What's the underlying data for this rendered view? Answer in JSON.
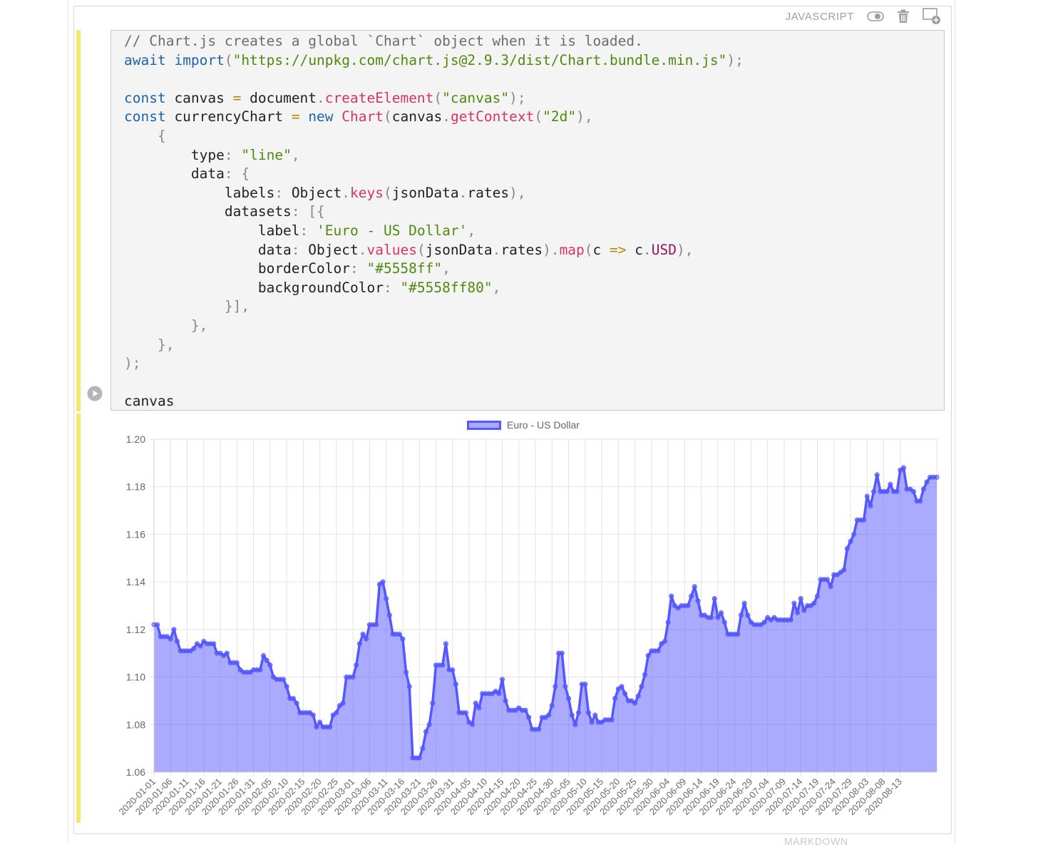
{
  "cell": {
    "language": "JAVASCRIPT",
    "code": [
      [
        [
          "com",
          "// Chart.js creates a global `Chart` object when it is loaded."
        ]
      ],
      [
        [
          "kw",
          "await"
        ],
        [
          "",
          "",
          ""
        ],
        [
          "txt",
          " "
        ],
        [
          "kw",
          "import"
        ],
        [
          "pun",
          "("
        ],
        [
          "str",
          "\"https://unpkg.com/chart.js@2.9.3/dist/Chart.bundle.min.js\""
        ],
        [
          "pun",
          ");"
        ]
      ],
      [],
      [
        [
          "kw",
          "const"
        ],
        [
          "txt",
          " canvas "
        ],
        [
          "op",
          "="
        ],
        [
          "txt",
          " document"
        ],
        [
          "pun",
          "."
        ],
        [
          "fn",
          "createElement"
        ],
        [
          "pun",
          "("
        ],
        [
          "str",
          "\"canvas\""
        ],
        [
          "pun",
          ");"
        ]
      ],
      [
        [
          "kw",
          "const"
        ],
        [
          "txt",
          " currencyChart "
        ],
        [
          "op",
          "="
        ],
        [
          "txt",
          " "
        ],
        [
          "kw",
          "new"
        ],
        [
          "txt",
          " "
        ],
        [
          "fn",
          "Chart"
        ],
        [
          "pun",
          "("
        ],
        [
          "txt",
          "canvas"
        ],
        [
          "pun",
          "."
        ],
        [
          "fn",
          "getContext"
        ],
        [
          "pun",
          "("
        ],
        [
          "str",
          "\"2d\""
        ],
        [
          "pun",
          "),"
        ]
      ],
      [
        [
          "pun",
          "    {"
        ]
      ],
      [
        [
          "txt",
          "        type"
        ],
        [
          "pun",
          ": "
        ],
        [
          "str",
          "\"line\""
        ],
        [
          "pun",
          ","
        ]
      ],
      [
        [
          "txt",
          "        data"
        ],
        [
          "pun",
          ": {"
        ]
      ],
      [
        [
          "txt",
          "            labels"
        ],
        [
          "pun",
          ": "
        ],
        [
          "txt",
          "Object"
        ],
        [
          "pun",
          "."
        ],
        [
          "fn",
          "keys"
        ],
        [
          "pun",
          "("
        ],
        [
          "txt",
          "jsonData"
        ],
        [
          "pun",
          "."
        ],
        [
          "txt",
          "rates"
        ],
        [
          "pun",
          "),"
        ]
      ],
      [
        [
          "txt",
          "            datasets"
        ],
        [
          "pun",
          ": [{"
        ]
      ],
      [
        [
          "txt",
          "                label"
        ],
        [
          "pun",
          ": "
        ],
        [
          "str",
          "'Euro - US Dollar'"
        ],
        [
          "pun",
          ","
        ]
      ],
      [
        [
          "txt",
          "                data"
        ],
        [
          "pun",
          ": "
        ],
        [
          "txt",
          "Object"
        ],
        [
          "pun",
          "."
        ],
        [
          "fn",
          "values"
        ],
        [
          "pun",
          "("
        ],
        [
          "txt",
          "jsonData"
        ],
        [
          "pun",
          "."
        ],
        [
          "txt",
          "rates"
        ],
        [
          "pun",
          ")."
        ],
        [
          "fn",
          "map"
        ],
        [
          "pun",
          "("
        ],
        [
          "txt",
          "c "
        ],
        [
          "op",
          "=>"
        ],
        [
          "txt",
          " c"
        ],
        [
          "pun",
          "."
        ],
        [
          "prop",
          "USD"
        ],
        [
          "pun",
          "),"
        ]
      ],
      [
        [
          "txt",
          "                borderColor"
        ],
        [
          "pun",
          ": "
        ],
        [
          "str",
          "\"#5558ff\""
        ],
        [
          "pun",
          ","
        ]
      ],
      [
        [
          "txt",
          "                backgroundColor"
        ],
        [
          "pun",
          ": "
        ],
        [
          "str",
          "\"#5558ff80\""
        ],
        [
          "pun",
          ","
        ]
      ],
      [
        [
          "pun",
          "            }],"
        ]
      ],
      [
        [
          "pun",
          "        },"
        ]
      ],
      [
        [
          "pun",
          "    },"
        ]
      ],
      [
        [
          "pun",
          ");"
        ]
      ],
      [],
      [
        [
          "txt",
          "canvas"
        ]
      ]
    ],
    "bottom_cell_label": "MARKDOWN"
  },
  "colors": {
    "border": "#5558ff",
    "fill": "#5558ff80",
    "grid": "#e3e3e3",
    "tick": "#666666",
    "marker": "#f5e86a"
  },
  "icons": {
    "toggle": "toggle-icon",
    "delete": "trash-icon",
    "add_cell": "add-cell-icon",
    "run": "run-icon"
  },
  "chart_data": {
    "type": "area",
    "legend": "Euro - US Dollar",
    "legend_position": "top",
    "ylim": [
      1.06,
      1.2
    ],
    "yticks": [
      "1.20",
      "1.18",
      "1.16",
      "1.14",
      "1.12",
      "1.10",
      "1.08",
      "1.06"
    ],
    "grid": true,
    "x_start": "2020-01-01",
    "xtick_labels": [
      "2020-01-01",
      "2020-01-06",
      "2020-01-11",
      "2020-01-16",
      "2020-01-21",
      "2020-01-26",
      "2020-01-31",
      "2020-02-05",
      "2020-02-10",
      "2020-02-15",
      "2020-02-20",
      "2020-02-25",
      "2020-03-01",
      "2020-03-06",
      "2020-03-11",
      "2020-03-16",
      "2020-03-21",
      "2020-03-26",
      "2020-03-31",
      "2020-04-05",
      "2020-04-10",
      "2020-04-15",
      "2020-04-20",
      "2020-04-25",
      "2020-04-30",
      "2020-05-05",
      "2020-05-10",
      "2020-05-15",
      "2020-05-20",
      "2020-05-25",
      "2020-05-30",
      "2020-06-04",
      "2020-06-09",
      "2020-06-14",
      "2020-06-19",
      "2020-06-24",
      "2020-06-29",
      "2020-07-04",
      "2020-07-09",
      "2020-07-14",
      "2020-07-19",
      "2020-07-24",
      "2020-07-29",
      "2020-08-03",
      "2020-08-08",
      "2020-08-13"
    ],
    "values": [
      1.122,
      1.122,
      1.117,
      1.117,
      1.117,
      1.116,
      1.12,
      1.115,
      1.111,
      1.111,
      1.111,
      1.111,
      1.112,
      1.114,
      1.113,
      1.115,
      1.114,
      1.114,
      1.114,
      1.11,
      1.11,
      1.109,
      1.11,
      1.106,
      1.106,
      1.106,
      1.103,
      1.102,
      1.102,
      1.102,
      1.103,
      1.103,
      1.103,
      1.109,
      1.107,
      1.105,
      1.1,
      1.099,
      1.099,
      1.099,
      1.096,
      1.091,
      1.091,
      1.089,
      1.085,
      1.085,
      1.085,
      1.085,
      1.084,
      1.079,
      1.081,
      1.079,
      1.079,
      1.079,
      1.084,
      1.085,
      1.088,
      1.089,
      1.1,
      1.1,
      1.1,
      1.105,
      1.114,
      1.118,
      1.116,
      1.122,
      1.122,
      1.122,
      1.139,
      1.14,
      1.133,
      1.126,
      1.118,
      1.118,
      1.118,
      1.116,
      1.102,
      1.096,
      1.066,
      1.066,
      1.066,
      1.07,
      1.077,
      1.08,
      1.089,
      1.105,
      1.105,
      1.105,
      1.114,
      1.103,
      1.103,
      1.097,
      1.085,
      1.085,
      1.085,
      1.081,
      1.08,
      1.089,
      1.087,
      1.093,
      1.093,
      1.093,
      1.093,
      1.094,
      1.093,
      1.099,
      1.09,
      1.086,
      1.086,
      1.086,
      1.087,
      1.086,
      1.086,
      1.083,
      1.078,
      1.078,
      1.078,
      1.083,
      1.083,
      1.084,
      1.088,
      1.096,
      1.11,
      1.11,
      1.096,
      1.091,
      1.084,
      1.08,
      1.085,
      1.097,
      1.097,
      1.085,
      1.081,
      1.084,
      1.081,
      1.081,
      1.082,
      1.082,
      1.082,
      1.091,
      1.095,
      1.096,
      1.093,
      1.09,
      1.09,
      1.089,
      1.092,
      1.096,
      1.101,
      1.109,
      1.111,
      1.111,
      1.111,
      1.114,
      1.115,
      1.123,
      1.134,
      1.13,
      1.129,
      1.13,
      1.13,
      1.13,
      1.134,
      1.138,
      1.132,
      1.126,
      1.126,
      1.125,
      1.125,
      1.133,
      1.125,
      1.127,
      1.123,
      1.118,
      1.118,
      1.118,
      1.118,
      1.126,
      1.131,
      1.126,
      1.123,
      1.122,
      1.122,
      1.122,
      1.123,
      1.125,
      1.124,
      1.125,
      1.124,
      1.124,
      1.124,
      1.124,
      1.124,
      1.131,
      1.127,
      1.133,
      1.128,
      1.13,
      1.13,
      1.131,
      1.134,
      1.141,
      1.141,
      1.141,
      1.138,
      1.143,
      1.143,
      1.144,
      1.145,
      1.154,
      1.157,
      1.16,
      1.166,
      1.166,
      1.166,
      1.176,
      1.172,
      1.178,
      1.185,
      1.178,
      1.178,
      1.178,
      1.181,
      1.178,
      1.178,
      1.187,
      1.188,
      1.179,
      1.179,
      1.178,
      1.174,
      1.174,
      1.179,
      1.182,
      1.184,
      1.184,
      1.184
    ]
  }
}
